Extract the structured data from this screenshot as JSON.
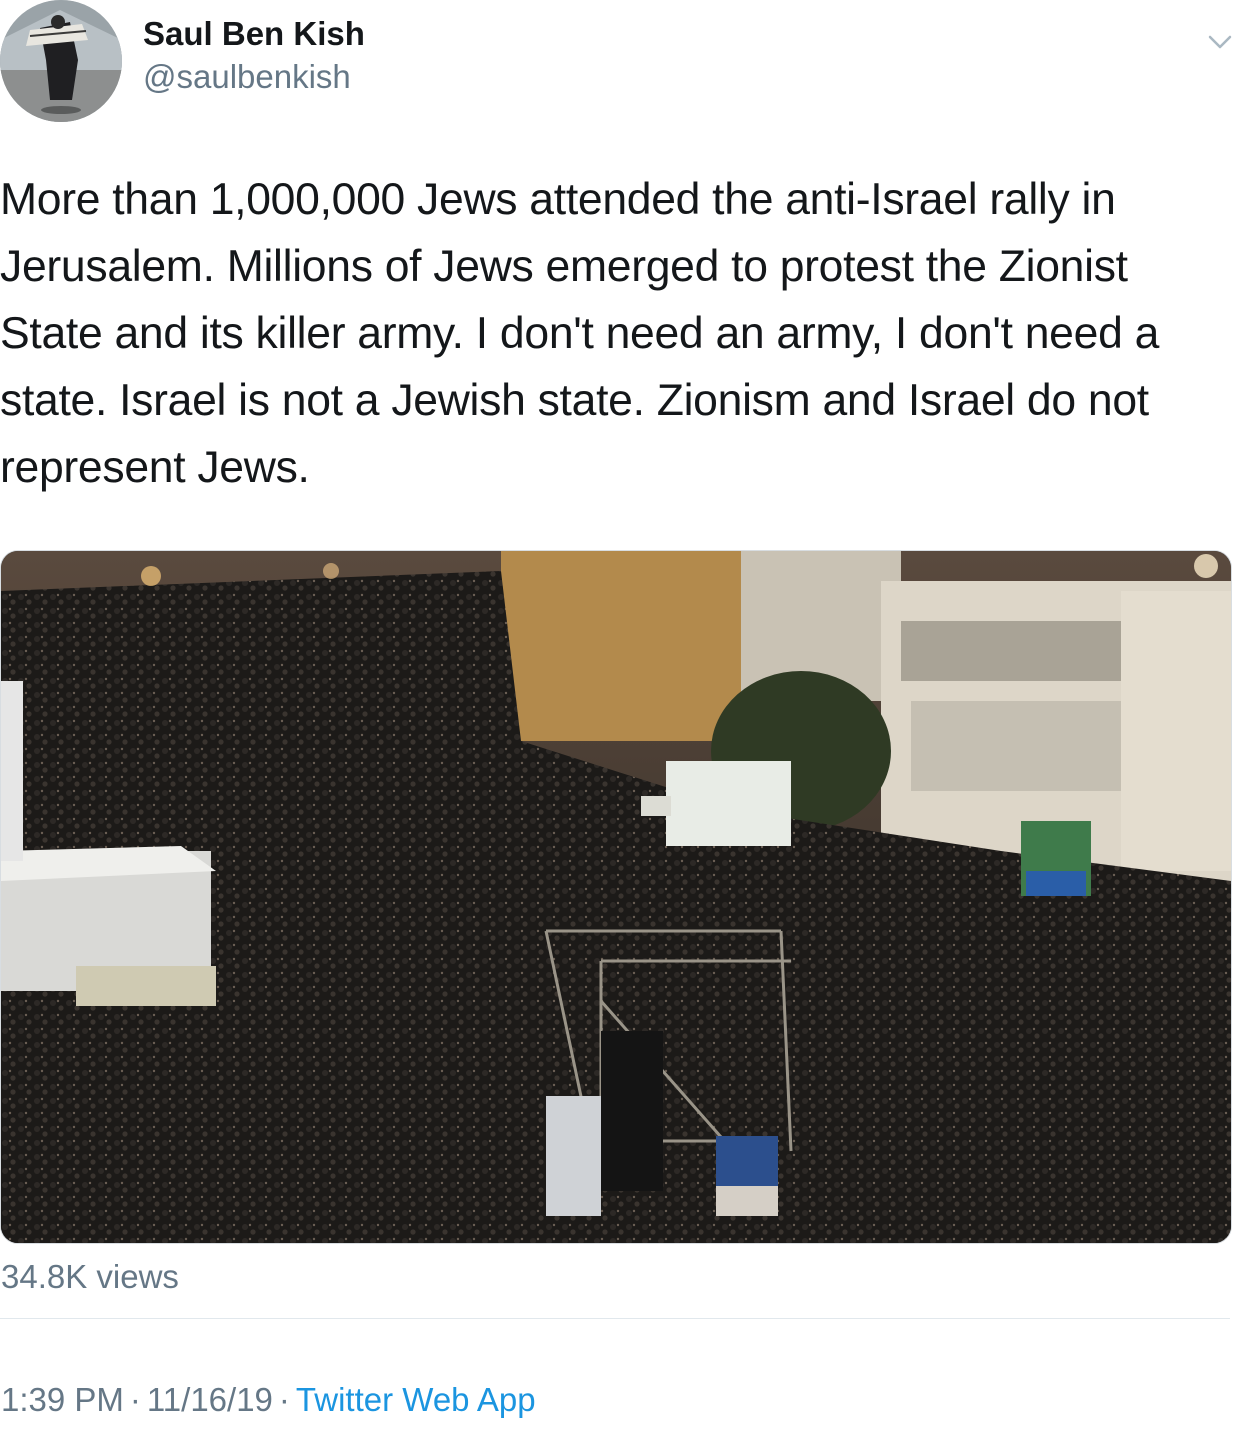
{
  "author": {
    "name": "Saul Ben Kish",
    "handle": "@saulbenkish"
  },
  "tweet": {
    "text": "More than 1,000,000 Jews attended the anti-Israel rally in Jerusalem. Millions of Jews emerged to protest the Zionist State and its killer army. I don't need an army, I don't need a state. Israel is not a Jewish state. Zionism and Israel do not represent Jews.",
    "views": "34.8K views",
    "time": "1:39 PM",
    "date": "11/16/19",
    "separator": "·",
    "source": "Twitter Web App"
  },
  "icons": {
    "menu": "chevron-down-icon"
  },
  "colors": {
    "text": "#14171a",
    "secondary": "#657786",
    "link": "#1b95e0",
    "divider": "#e1e8ed"
  }
}
